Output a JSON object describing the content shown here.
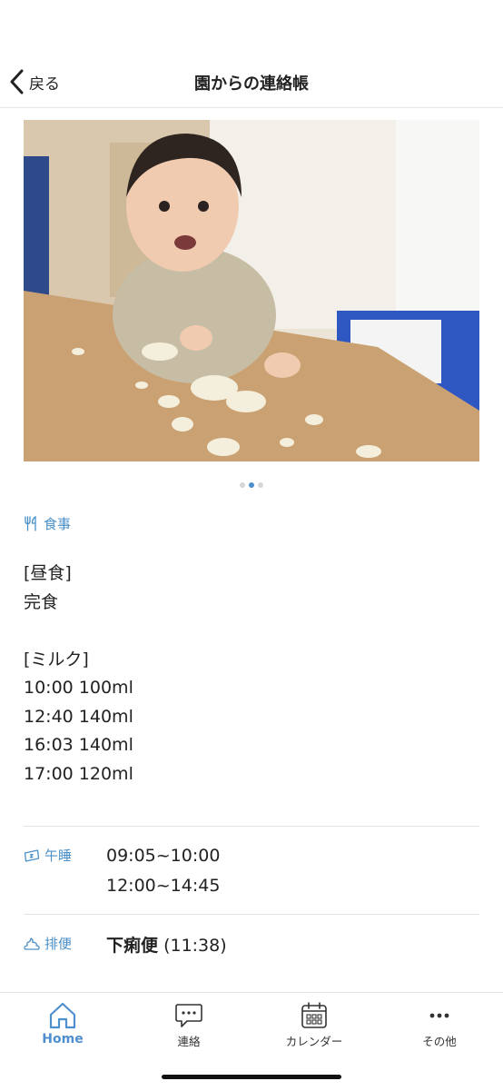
{
  "header": {
    "back_label": "戻る",
    "title": "園からの連絡帳"
  },
  "carousel": {
    "page_count": 3,
    "active_index": 1
  },
  "meal": {
    "label": "食事",
    "lines": [
      "[昼食]",
      "完食",
      "",
      "[ミルク]",
      "10:00 100ml",
      "12:40 140ml",
      "16:03 140ml",
      "17:00 120ml"
    ]
  },
  "nap": {
    "label": "午睡",
    "times": [
      "09:05~10:00",
      "12:00~14:45"
    ]
  },
  "stool": {
    "label": "排便",
    "value": "下痢便",
    "time": "(11:38)"
  },
  "tabbar": {
    "home": "Home",
    "messages": "連絡",
    "calendar": "カレンダー",
    "other": "その他"
  },
  "colors": {
    "accent": "#4e8fcf",
    "label": "#4a90c8"
  }
}
